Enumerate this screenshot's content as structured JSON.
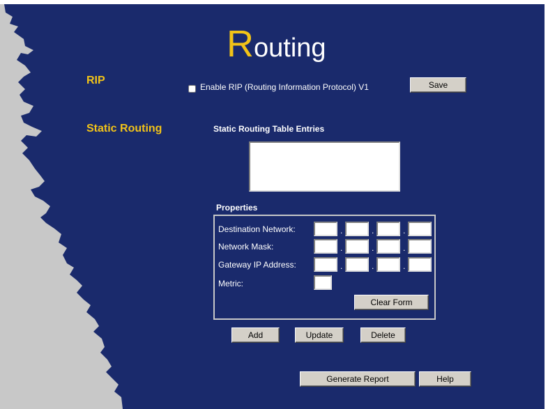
{
  "page": {
    "title_initial": "R",
    "title_rest": "outing"
  },
  "rip": {
    "section_label": "RIP",
    "enable_label": "Enable RIP (Routing Information Protocol) V1",
    "enable_checked": false,
    "save_label": "Save"
  },
  "static_routing": {
    "section_label": "Static Routing",
    "table_heading": "Static Routing Table Entries",
    "entries": []
  },
  "properties": {
    "heading": "Properties",
    "destination_label": "Destination Network:",
    "mask_label": "Network Mask:",
    "gateway_label": "Gateway IP Address:",
    "metric_label": "Metric:",
    "destination_values": [
      "",
      "",
      "",
      ""
    ],
    "mask_values": [
      "",
      "",
      "",
      ""
    ],
    "gateway_values": [
      "",
      "",
      "",
      ""
    ],
    "metric_value": "",
    "clear_form_label": "Clear Form"
  },
  "actions": {
    "add_label": "Add",
    "update_label": "Update",
    "delete_label": "Delete"
  },
  "footer": {
    "generate_report_label": "Generate Report",
    "help_label": "Help"
  },
  "colors": {
    "panel_background": "#1a2a6c",
    "accent": "#f2c318",
    "edge": "#c8c8c8"
  }
}
